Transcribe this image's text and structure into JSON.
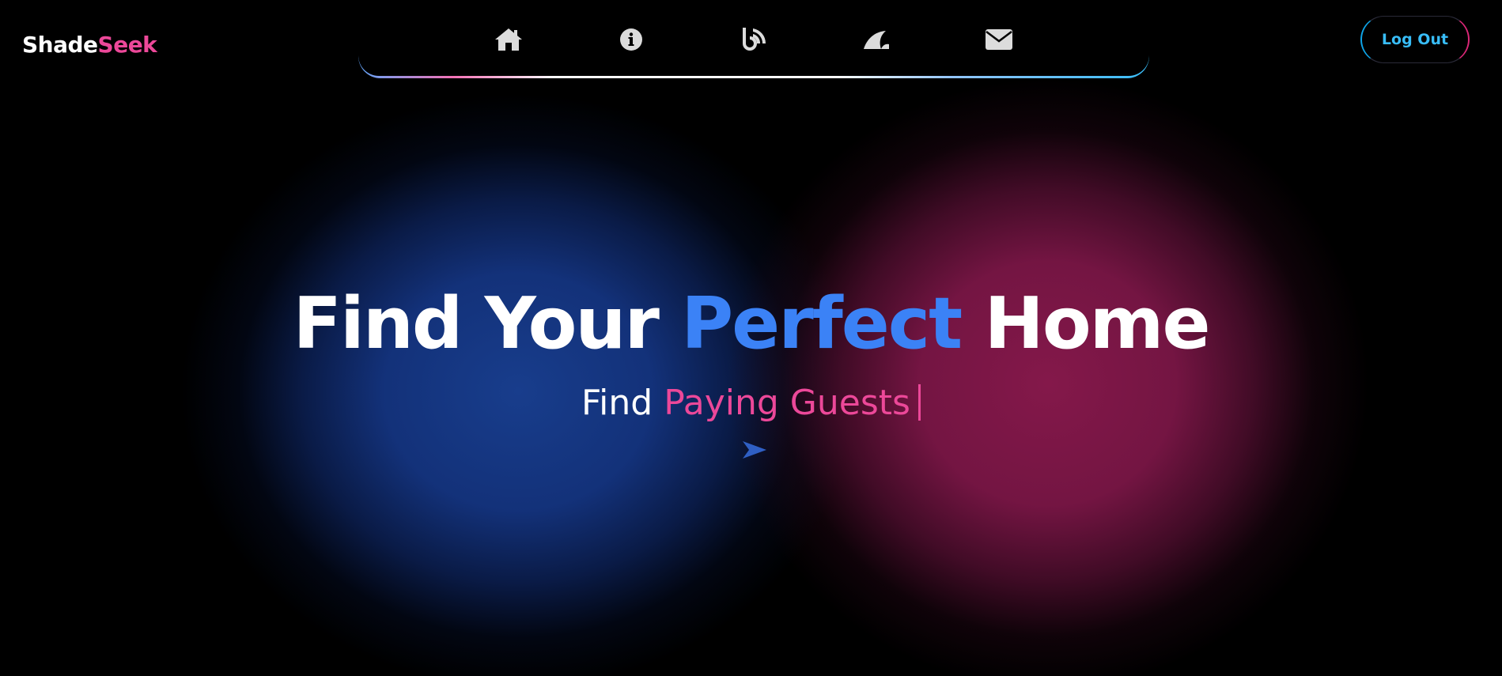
{
  "brand": {
    "name_part1": "Shade",
    "name_part2": "Seek",
    "primary_color": "#ffffff",
    "accent_color": "#ec4899"
  },
  "nav": {
    "items": [
      {
        "icon": "home-icon"
      },
      {
        "icon": "info-icon"
      },
      {
        "icon": "blog-icon"
      },
      {
        "icon": "shark-fin-icon"
      },
      {
        "icon": "envelope-icon"
      }
    ]
  },
  "header": {
    "logout_label": "Log Out"
  },
  "hero": {
    "title_part1": "Find Your ",
    "title_accent": "Perfect",
    "title_part2": " Home",
    "subtitle_prefix": "Find ",
    "subtitle_typed": "Paying Guests"
  },
  "colors": {
    "background": "#000000",
    "blue_accent": "#3b82f6",
    "pink_accent": "#ec4899",
    "glow_blue": "#183d8c",
    "glow_pink": "#84184a"
  }
}
